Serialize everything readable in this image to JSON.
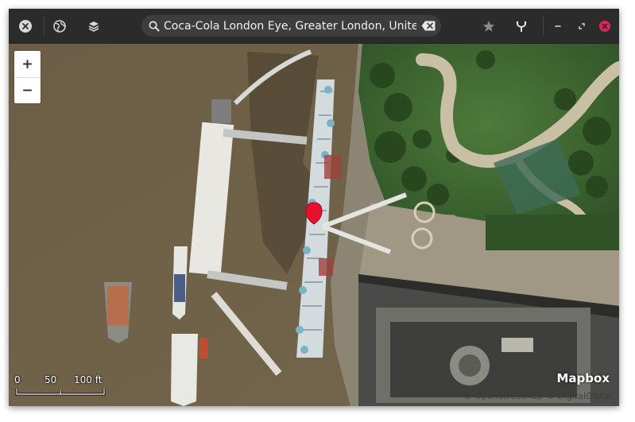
{
  "titlebar": {
    "search_value": "Coca-Cola London Eye, Greater London, United Kingdom",
    "icons": {
      "close": "close-icon",
      "globe": "globe-icon",
      "layers": "layers-icon",
      "search": "search-icon",
      "clear": "clear-search-icon",
      "star": "star-icon",
      "route": "route-icon",
      "minimize": "minimize-icon",
      "restore": "restore-icon",
      "window_close": "window-close-icon"
    },
    "colors": {
      "window_close_accent": "#e0245e",
      "marker": "#e8102e"
    }
  },
  "map": {
    "zoom_in_label": "+",
    "zoom_out_label": "−",
    "scale": {
      "labels": [
        "0",
        "50",
        "100 ft"
      ]
    },
    "logo": "Mapbox",
    "attribution": "© OpenStreetMap © DigitalGlobe"
  }
}
